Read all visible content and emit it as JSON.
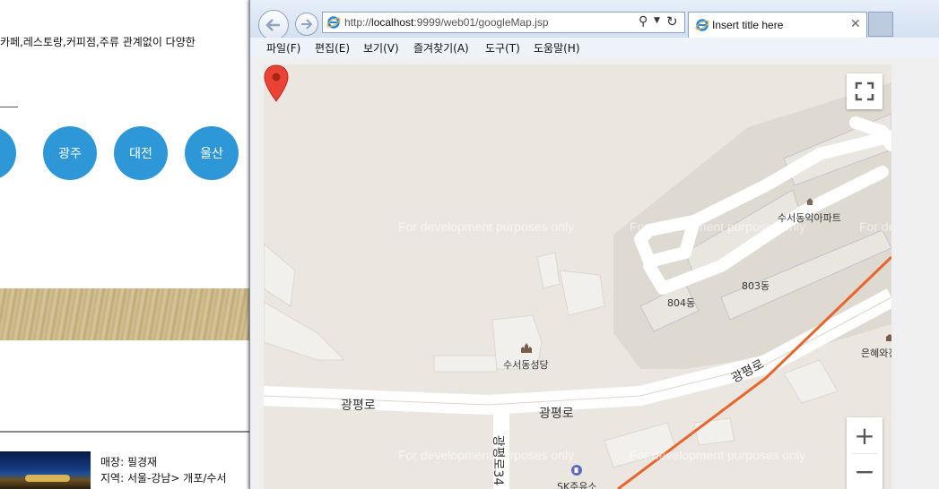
{
  "background_page": {
    "description": "카페,레스토랑,커피점,주류 관계없이 다양한",
    "cities": [
      "광주",
      "대전",
      "울산"
    ],
    "store_info": {
      "name": "매장: 필경재",
      "region": "지역: 서울-강남> 개포/수서"
    }
  },
  "browser": {
    "url_prefix": "http://",
    "url_host": "localhost",
    "url_rest": ":9999/web01/googleMap.jsp",
    "tab_title": "Insert title here",
    "menu": [
      "파일(F)",
      "편집(E)",
      "보기(V)",
      "즐겨찾기(A)",
      "도구(T)",
      "도움말(H)"
    ]
  },
  "map": {
    "watermark": "For development purposes only",
    "labels": {
      "apartment": "수서동익아파트",
      "bldg_803": "803동",
      "bldg_804": "804동",
      "church": "수서동성당",
      "road_main": "광평로",
      "road_diag": "광평로",
      "road_side": "광평로34",
      "gas_station": "SK주유소",
      "right_poi": "은혜와진"
    },
    "controls": {
      "zoom_in": "+",
      "zoom_out": "−"
    },
    "colors": {
      "marker": "#ea4335",
      "subway_line": "#e8652c",
      "city_circle": "#2e97d8"
    },
    "icons": [
      "fullscreen-icon",
      "map-marker-icon",
      "church-icon",
      "home-icon",
      "gas-station-icon"
    ]
  }
}
